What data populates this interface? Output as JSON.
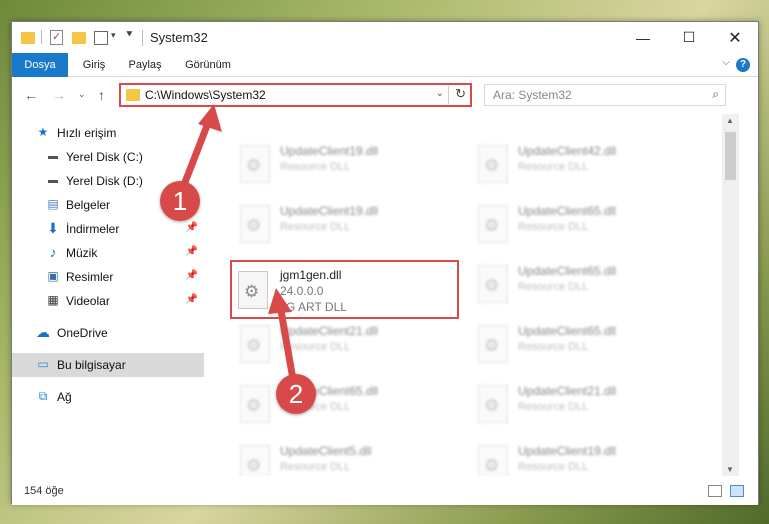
{
  "window": {
    "title": "System32",
    "minimize_glyph": "—",
    "maximize_glyph": "☐",
    "close_glyph": "✕"
  },
  "ribbon": {
    "tabs": [
      {
        "label": "Dosya"
      },
      {
        "label": "Giriş"
      },
      {
        "label": "Paylaş"
      },
      {
        "label": "Görünüm"
      }
    ]
  },
  "address": {
    "path": "C:\\Windows\\System32",
    "search_placeholder": "Ara: System32"
  },
  "sidebar": {
    "items": [
      {
        "label": "Hızlı erişim",
        "icon": "star-icon"
      },
      {
        "label": "Yerel Disk (C:)",
        "icon": "drive-icon"
      },
      {
        "label": "Yerel Disk (D:)",
        "icon": "drive-icon"
      },
      {
        "label": "Belgeler",
        "icon": "documents-icon"
      },
      {
        "label": "İndirmeler",
        "icon": "download-icon"
      },
      {
        "label": "Müzik",
        "icon": "music-icon"
      },
      {
        "label": "Resimler",
        "icon": "pictures-icon"
      },
      {
        "label": "Videolar",
        "icon": "videos-icon"
      },
      {
        "label": "OneDrive",
        "icon": "cloud-icon"
      },
      {
        "label": "Bu bilgisayar",
        "icon": "computer-icon"
      },
      {
        "label": "Ağ",
        "icon": "network-icon"
      }
    ]
  },
  "files": {
    "blurred": [
      {
        "name": "UpdateClient19.dll",
        "desc": "Resource DLL"
      },
      {
        "name": "UpdateClient42.dll",
        "desc": "Resource DLL"
      },
      {
        "name": "UpdateClient19.dll",
        "desc": "Resource DLL"
      },
      {
        "name": "UpdateClient65.dll",
        "desc": "Resource DLL"
      },
      {
        "name": "UpdateClient65.dll",
        "desc": "Resource DLL"
      },
      {
        "name": "UpdateClient21.dll",
        "desc": "Resource DLL"
      },
      {
        "name": "UpdateClient65.dll",
        "desc": "Resource DLL"
      },
      {
        "name": "UpdateClient65.dll",
        "desc": "Resource DLL"
      },
      {
        "name": "UpdateClient65.dll",
        "desc": "Resource DLL"
      },
      {
        "name": "UpdateClient21.dll",
        "desc": "Resource DLL"
      },
      {
        "name": "UpdateClient5.dll",
        "desc": "Resource DLL"
      },
      {
        "name": "UpdateClient19.dll",
        "desc": "Resource DLL"
      }
    ],
    "highlighted": {
      "name": "jgm1gen.dll",
      "version": "24.0.0.0",
      "desc": "JG ART DLL"
    }
  },
  "status": {
    "item_count": "154 öğe"
  },
  "annotations": {
    "badge_1": "1",
    "badge_2": "2",
    "color": "#d84a4a"
  }
}
